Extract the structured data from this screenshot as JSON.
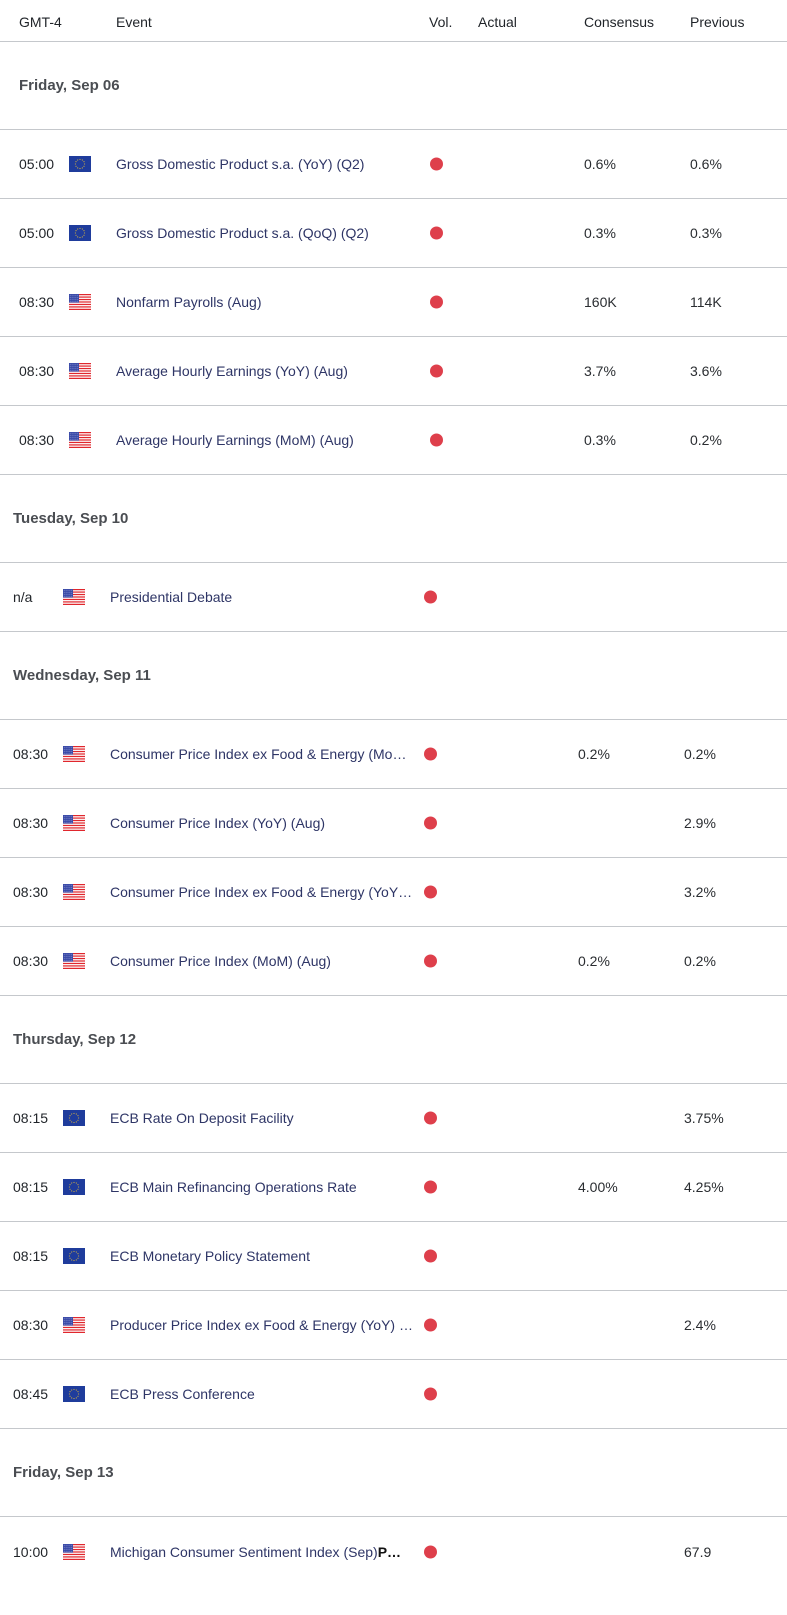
{
  "colors": {
    "volatility_high": "#de3f4b",
    "event_text": "#2e3566",
    "divider": "#c5c8cc",
    "eu_flag_blue": "#1f3c9c",
    "eu_flag_stars": "#f2c230",
    "us_flag_red": "#e0272d",
    "us_flag_blue": "#3a4aa8"
  },
  "header": {
    "timezone": "GMT-4",
    "event": "Event",
    "volatility": "Vol.",
    "actual": "Actual",
    "consensus": "Consensus",
    "previous": "Previous"
  },
  "days": [
    {
      "label": "Friday, Sep 06",
      "events": [
        {
          "time": "05:00",
          "country_flag": "eu-flag-icon",
          "event": "Gross Domestic Product s.a. (YoY) (Q2)",
          "volatility": "high",
          "actual": "",
          "consensus": "0.6%",
          "previous": "0.6%"
        },
        {
          "time": "05:00",
          "country_flag": "eu-flag-icon",
          "event": "Gross Domestic Product s.a. (QoQ) (Q2)",
          "volatility": "high",
          "actual": "",
          "consensus": "0.3%",
          "previous": "0.3%"
        },
        {
          "time": "08:30",
          "country_flag": "us-flag-icon",
          "event": "Nonfarm Payrolls (Aug)",
          "volatility": "high",
          "actual": "",
          "consensus": "160K",
          "previous": "114K"
        },
        {
          "time": "08:30",
          "country_flag": "us-flag-icon",
          "event": "Average Hourly Earnings (YoY) (Aug)",
          "volatility": "high",
          "actual": "",
          "consensus": "3.7%",
          "previous": "3.6%"
        },
        {
          "time": "08:30",
          "country_flag": "us-flag-icon",
          "event": "Average Hourly Earnings (MoM) (Aug)",
          "volatility": "high",
          "actual": "",
          "consensus": "0.3%",
          "previous": "0.2%"
        }
      ]
    },
    {
      "label": "Tuesday, Sep 10",
      "events": [
        {
          "time": "n/a",
          "country_flag": "us-flag-icon",
          "event": "Presidential Debate",
          "volatility": "high",
          "actual": "",
          "consensus": "",
          "previous": ""
        }
      ]
    },
    {
      "label": "Wednesday, Sep 11",
      "events": [
        {
          "time": "08:30",
          "country_flag": "us-flag-icon",
          "event": "Consumer Price Index ex Food & Energy (Mo…",
          "volatility": "high",
          "actual": "",
          "consensus": "0.2%",
          "previous": "0.2%"
        },
        {
          "time": "08:30",
          "country_flag": "us-flag-icon",
          "event": "Consumer Price Index (YoY) (Aug)",
          "volatility": "high",
          "actual": "",
          "consensus": "",
          "previous": "2.9%"
        },
        {
          "time": "08:30",
          "country_flag": "us-flag-icon",
          "event": "Consumer Price Index ex Food & Energy (YoY…",
          "volatility": "high",
          "actual": "",
          "consensus": "",
          "previous": "3.2%"
        },
        {
          "time": "08:30",
          "country_flag": "us-flag-icon",
          "event": "Consumer Price Index (MoM) (Aug)",
          "volatility": "high",
          "actual": "",
          "consensus": "0.2%",
          "previous": "0.2%"
        }
      ]
    },
    {
      "label": "Thursday, Sep 12",
      "events": [
        {
          "time": "08:15",
          "country_flag": "eu-flag-icon",
          "event": "ECB Rate On Deposit Facility",
          "volatility": "high",
          "actual": "",
          "consensus": "",
          "previous": "3.75%"
        },
        {
          "time": "08:15",
          "country_flag": "eu-flag-icon",
          "event": "ECB Main Refinancing Operations Rate",
          "volatility": "high",
          "actual": "",
          "consensus": "4.00%",
          "previous": "4.25%"
        },
        {
          "time": "08:15",
          "country_flag": "eu-flag-icon",
          "event": "ECB Monetary Policy Statement",
          "volatility": "high",
          "actual": "",
          "consensus": "",
          "previous": ""
        },
        {
          "time": "08:30",
          "country_flag": "us-flag-icon",
          "event": "Producer Price Index ex Food & Energy (YoY) …",
          "volatility": "high",
          "actual": "",
          "consensus": "",
          "previous": "2.4%"
        },
        {
          "time": "08:45",
          "country_flag": "eu-flag-icon",
          "event": "ECB Press Conference",
          "volatility": "high",
          "actual": "",
          "consensus": "",
          "previous": ""
        }
      ]
    },
    {
      "label": "Friday, Sep 13",
      "events": [
        {
          "time": "10:00",
          "country_flag": "us-flag-icon",
          "event": "Michigan Consumer Sentiment Index (Sep)",
          "event_suffix_bold": "P…",
          "volatility": "high",
          "actual": "",
          "consensus": "",
          "previous": "67.9"
        }
      ]
    }
  ]
}
